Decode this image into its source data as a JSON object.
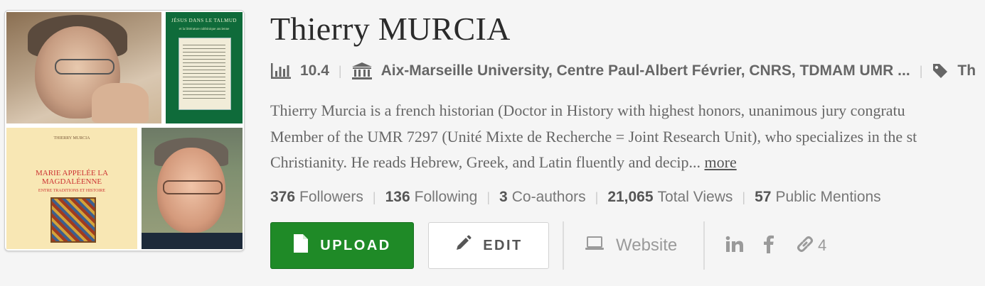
{
  "profile": {
    "name": "Thierry MURCIA",
    "score": "10.4",
    "affiliation": "Aix-Marseille University, Centre Paul-Albert Février, CNRS, TDMAM UMR ...",
    "tags_truncated": "Th",
    "bio_lines": [
      "Thierry Murcia is a french historian (Doctor in History with highest honors, unanimous jury congratu",
      "Member of the UMR 7297 (Unité Mixte de Recherche = Joint Research Unit), who specializes in the st",
      "Christianity. He reads Hebrew, Greek, and Latin fluently and decip..."
    ],
    "more_link": "more"
  },
  "collage": {
    "book1_title": "JÉSUS DANS LE TALMUD",
    "book1_subtitle": "et la littérature rabbinique ancienne",
    "book2_author": "THIERRY MURCIA",
    "book2_title": "MARIE APPELÉE LA MAGDALÉENNE",
    "book2_subtitle": "ENTRE TRADITIONS ET HISTOIRE"
  },
  "stats": {
    "followers_count": "376",
    "followers_label": "Followers",
    "following_count": "136",
    "following_label": "Following",
    "coauthors_count": "3",
    "coauthors_label": "Co-authors",
    "views_count": "21,065",
    "views_label": "Total Views",
    "mentions_count": "57",
    "mentions_label": "Public Mentions"
  },
  "actions": {
    "upload_label": "UPLOAD",
    "edit_label": "EDIT",
    "website_label": "Website",
    "links_count": "4"
  },
  "icons": {
    "score": "bar-chart-icon",
    "affiliation": "institution-icon",
    "tags": "tag-icon",
    "upload": "file-icon",
    "edit": "pencil-icon",
    "website": "laptop-icon",
    "linkedin": "linkedin-icon",
    "facebook": "facebook-icon",
    "links": "link-icon"
  },
  "colors": {
    "upload_button": "#1f8a27",
    "text_muted": "#777777",
    "background": "#f5f5f5"
  }
}
